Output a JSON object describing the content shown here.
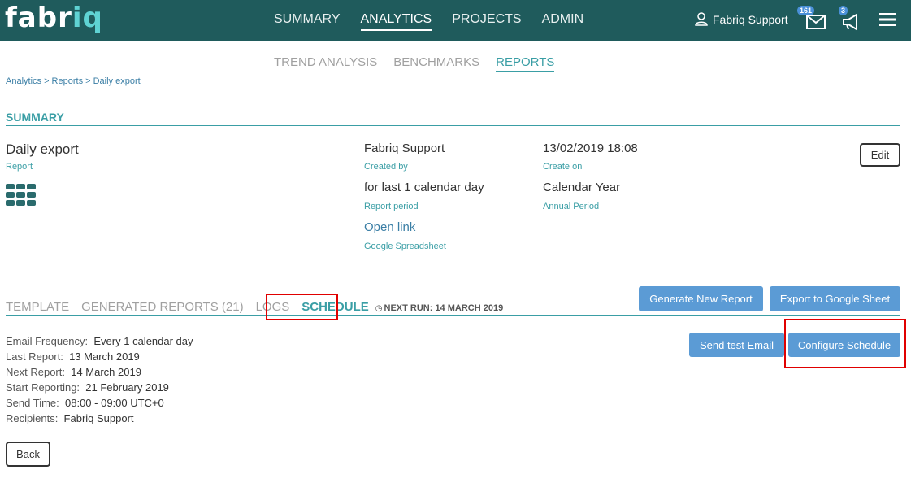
{
  "header": {
    "logo_main": "fabr",
    "logo_accent": "iq",
    "nav": [
      "SUMMARY",
      "ANALYTICS",
      "PROJECTS",
      "ADMIN"
    ],
    "active_nav": "ANALYTICS",
    "user_name": "Fabriq Support",
    "mail_count": "161",
    "announce_count": "3"
  },
  "subnav": [
    "TREND ANALYSIS",
    "BENCHMARKS",
    "REPORTS"
  ],
  "breadcrumb": "Analytics > Reports > Daily export",
  "summary": {
    "title": "SUMMARY",
    "name": "Daily export",
    "name_sub": "Report",
    "created_by": "Fabriq Support",
    "created_by_label": "Created by",
    "created_on": "13/02/2019 18:08",
    "created_on_label": "Create on",
    "period": "for last 1 calendar day",
    "period_label": "Report period",
    "annual": "Calendar Year",
    "annual_label": "Annual Period",
    "link": "Open link",
    "link_label": "Google Spreadsheet",
    "edit_label": "Edit"
  },
  "tabs": {
    "template": "TEMPLATE",
    "generated": "GENERATED REPORTS (21)",
    "logs": "LOGS",
    "schedule": "SCHEDULE",
    "next_run": "NEXT RUN: 14 MARCH 2019"
  },
  "buttons": {
    "generate": "Generate New Report",
    "export": "Export to Google Sheet",
    "test_email": "Send test Email",
    "configure": "Configure Schedule",
    "back": "Back"
  },
  "schedule": [
    {
      "label": "Email Frequency:",
      "value": "Every 1 calendar day"
    },
    {
      "label": "Last Report:",
      "value": "13 March 2019"
    },
    {
      "label": "Next Report:",
      "value": "14 March 2019"
    },
    {
      "label": "Start Reporting:",
      "value": "21 February 2019"
    },
    {
      "label": "Send Time:",
      "value": "08:00 - 09:00 UTC+0"
    },
    {
      "label": "Recipients:",
      "value": "Fabriq Support"
    }
  ]
}
